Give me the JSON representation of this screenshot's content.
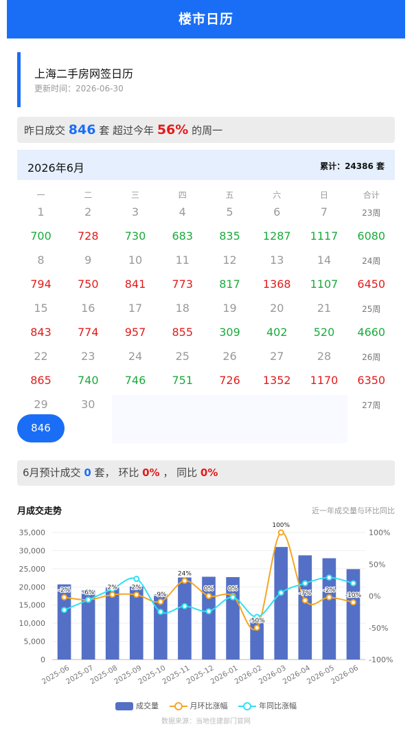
{
  "header": {
    "title": "楼市日历"
  },
  "title_card": {
    "title": "上海二手房网签日历",
    "updated": "更新时间：2026-06-30"
  },
  "summary": {
    "p1": "昨日成交",
    "count": "846",
    "p2": "套 超过今年",
    "pct": "56%",
    "p3": "的周一"
  },
  "calendar": {
    "month": "2026年6月",
    "total": "累计：24386 套",
    "weekdays": [
      "一",
      "二",
      "三",
      "四",
      "五",
      "六",
      "日",
      "合计"
    ],
    "weeks": [
      {
        "days": [
          "1",
          "2",
          "3",
          "4",
          "5",
          "6",
          "7"
        ],
        "label": "23周",
        "values": [
          {
            "v": "700",
            "c": "green"
          },
          {
            "v": "728",
            "c": "red"
          },
          {
            "v": "730",
            "c": "green"
          },
          {
            "v": "683",
            "c": "green"
          },
          {
            "v": "835",
            "c": "green"
          },
          {
            "v": "1287",
            "c": "green"
          },
          {
            "v": "1117",
            "c": "green"
          },
          {
            "v": "6080",
            "c": "green"
          }
        ]
      },
      {
        "days": [
          "8",
          "9",
          "10",
          "11",
          "12",
          "13",
          "14"
        ],
        "label": "24周",
        "values": [
          {
            "v": "794",
            "c": "red"
          },
          {
            "v": "750",
            "c": "red"
          },
          {
            "v": "841",
            "c": "red"
          },
          {
            "v": "773",
            "c": "red"
          },
          {
            "v": "817",
            "c": "green"
          },
          {
            "v": "1368",
            "c": "red"
          },
          {
            "v": "1107",
            "c": "green"
          },
          {
            "v": "6450",
            "c": "red"
          }
        ]
      },
      {
        "days": [
          "15",
          "16",
          "17",
          "18",
          "19",
          "20",
          "21"
        ],
        "label": "25周",
        "values": [
          {
            "v": "843",
            "c": "red"
          },
          {
            "v": "774",
            "c": "red"
          },
          {
            "v": "957",
            "c": "red"
          },
          {
            "v": "855",
            "c": "red"
          },
          {
            "v": "309",
            "c": "green"
          },
          {
            "v": "402",
            "c": "green"
          },
          {
            "v": "520",
            "c": "green"
          },
          {
            "v": "4660",
            "c": "green"
          }
        ]
      },
      {
        "days": [
          "22",
          "23",
          "24",
          "25",
          "26",
          "27",
          "28"
        ],
        "label": "26周",
        "values": [
          {
            "v": "865",
            "c": "red"
          },
          {
            "v": "740",
            "c": "green"
          },
          {
            "v": "746",
            "c": "green"
          },
          {
            "v": "751",
            "c": "green"
          },
          {
            "v": "726",
            "c": "red"
          },
          {
            "v": "1352",
            "c": "red"
          },
          {
            "v": "1170",
            "c": "red"
          },
          {
            "v": "6350",
            "c": "red"
          }
        ]
      },
      {
        "days": [
          "29",
          "30"
        ],
        "label": "27周",
        "values": [],
        "today_value": "846"
      }
    ]
  },
  "forecast": {
    "p1": "6月预计成交",
    "count": "0",
    "p2": "套，  环比",
    "mom": "0%",
    "p3": "，  同比",
    "yoy": "0%"
  },
  "trend": {
    "title": "月成交走势",
    "subtitle": "近一年成交量与环比同比"
  },
  "legend": {
    "bar": "成交量",
    "mom": "月环比涨幅",
    "yoy": "年同比涨幅"
  },
  "source": "数据来源：当地住建部门官网",
  "colors": {
    "primary": "#1a6ef6",
    "up": "#e21b1b",
    "down": "#1aaa3c",
    "bar": "#5470c6",
    "mom_line": "#f5a623",
    "yoy_line": "#2fe0f0"
  },
  "chart_data": {
    "type": "bar",
    "categories": [
      "2025-06",
      "2025-07",
      "2025-08",
      "2025-09",
      "2025-10",
      "2025-11",
      "2025-12",
      "2026-01",
      "2026-02",
      "2026-03",
      "2026-04",
      "2026-05",
      "2026-06"
    ],
    "series": [
      {
        "name": "成交量",
        "type": "bar",
        "axis": "left",
        "values": [
          20700,
          19000,
          19800,
          20100,
          18100,
          22600,
          22800,
          22700,
          11200,
          31000,
          28700,
          27900,
          24900
        ]
      },
      {
        "name": "月环比涨幅",
        "type": "line",
        "axis": "right",
        "values": [
          -2,
          -6,
          2,
          2,
          -9,
          24,
          0,
          0,
          -50,
          100,
          -7,
          -2,
          -10
        ],
        "labels": [
          "-2%",
          "-6%",
          "2%",
          "2%",
          "-9%",
          "24%",
          "0%",
          "0%",
          "-50%",
          "100%",
          "-7%",
          "-2%",
          "-10%"
        ]
      },
      {
        "name": "年同比涨幅",
        "type": "line",
        "axis": "right",
        "values": [
          -22,
          -6,
          11,
          27,
          -25,
          -16,
          -24,
          -2,
          -33,
          5,
          20,
          29,
          20
        ]
      }
    ],
    "left_axis": {
      "ylim": [
        0,
        35000
      ],
      "ticks": [
        "0",
        "5,000",
        "10,000",
        "15,000",
        "20,000",
        "25,000",
        "30,000",
        "35,000"
      ]
    },
    "right_axis": {
      "ylim": [
        -100,
        100
      ],
      "ticks": [
        "-100%",
        "-50%",
        "0%",
        "50%",
        "100%"
      ]
    },
    "grid": true,
    "legend_position": "bottom"
  }
}
